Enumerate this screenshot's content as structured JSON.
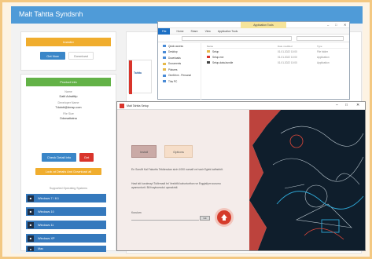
{
  "app": {
    "title": "Malt Tahtta Syndsnh"
  },
  "left_top_panel": {
    "header": "Installer",
    "btn_primary": "Get Now",
    "btn_secondary": "Download"
  },
  "left_info_panel": {
    "header": "Product Info",
    "lines": [
      {
        "label": "Name",
        "value": "Dattl Adrattttp"
      },
      {
        "label": "Developer Name",
        "value": "Tdotntt@dmsp.com"
      },
      {
        "label": "File Size",
        "value": "Ddsrsattatna"
      }
    ],
    "btn_primary": "Check Detail Info",
    "btn_red": "Get",
    "btn_orange": "Look at Details And Download all",
    "subtitle": "Supported Operating Systems"
  },
  "os_list": [
    {
      "label": "Windows 7 / 8.1",
      "icon": "windows-icon"
    },
    {
      "label": "Windows 10",
      "icon": "windows-icon"
    },
    {
      "label": "Windows 11",
      "icon": "windows-icon"
    },
    {
      "label": "Windows XP",
      "icon": "windows-icon"
    },
    {
      "label": "Mac",
      "icon": "apple-icon"
    }
  ],
  "explorer": {
    "tab_label": "Application Tools",
    "ribbon": {
      "file": "File",
      "home": "Home",
      "share": "Share",
      "view": "View",
      "manage": "Application Tools"
    },
    "nav": [
      "Quick access",
      "Desktop",
      "Downloads",
      "Documents",
      "Pictures",
      "OneDrive - Personal",
      "This PC"
    ],
    "columns": {
      "name": "Name",
      "date": "Date modified",
      "type": "Type"
    },
    "files": [
      {
        "name": "Setup",
        "date": "01.01.2022 10:00",
        "type": "File folder"
      },
      {
        "name": "Setup.exe",
        "date": "01.01.2022 10:00",
        "type": "Application"
      },
      {
        "name": "Setup-data-bundle",
        "date": "01.01.2022 10:00",
        "type": "Application"
      }
    ]
  },
  "product": {
    "box_title": "Tahtta"
  },
  "setup": {
    "title": "Malt Tahtta Setup",
    "btn_dark": "Install",
    "btn_light": "Options",
    "text1": "En Sorulft Kal Fakurtts Tekiknsdan sizin 1000 numalf ve hazir Eglek kafhstrklt.",
    "text2": "Hast isti kurulmayi Tutlirmadi bri Veshitlk kaburturthon ve Erggisliym surumu ayamunturit. Bil fvayiscmolui uymakrtdi.",
    "path_label": "Kurulum",
    "browse": "Gtt"
  },
  "colors": {
    "header": "#4f9bd8",
    "orange": "#f0ad2e",
    "green": "#63b247",
    "blue": "#3a86c8",
    "red": "#d9342b",
    "os_blue": "#3579bd",
    "frame": "#f3c882"
  }
}
